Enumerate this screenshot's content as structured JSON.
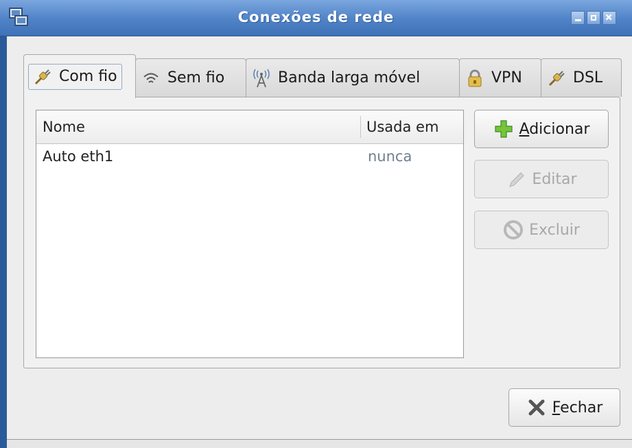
{
  "window": {
    "title": "Conexões de rede",
    "controls": [
      "minimize-icon",
      "maximize-icon",
      "close-icon"
    ]
  },
  "tabs": [
    {
      "label": "Com fio",
      "icon": "wired-plug-icon",
      "active": true
    },
    {
      "label": "Sem fio",
      "icon": "wireless-icon",
      "active": false
    },
    {
      "label": "Banda larga móvel",
      "icon": "antenna-icon",
      "active": false
    },
    {
      "label": "VPN",
      "icon": "lock-icon",
      "active": false
    },
    {
      "label": "DSL",
      "icon": "dsl-plug-icon",
      "active": false
    }
  ],
  "list": {
    "columns": [
      "Nome",
      "Usada em"
    ],
    "rows": [
      {
        "name": "Auto eth1",
        "used": "nunca"
      }
    ]
  },
  "buttons": {
    "add": {
      "mnemonic": "A",
      "rest": "dicionar",
      "enabled": true
    },
    "edit": {
      "label": "Editar",
      "enabled": false
    },
    "delete": {
      "label": "Excluir",
      "enabled": false
    },
    "close": {
      "mnemonic": "F",
      "rest": "echar",
      "enabled": true
    }
  },
  "colors": {
    "titlebar": "#4f82c6",
    "used_text": "#6f7f8f",
    "add_icon": "#6fbf3a"
  }
}
